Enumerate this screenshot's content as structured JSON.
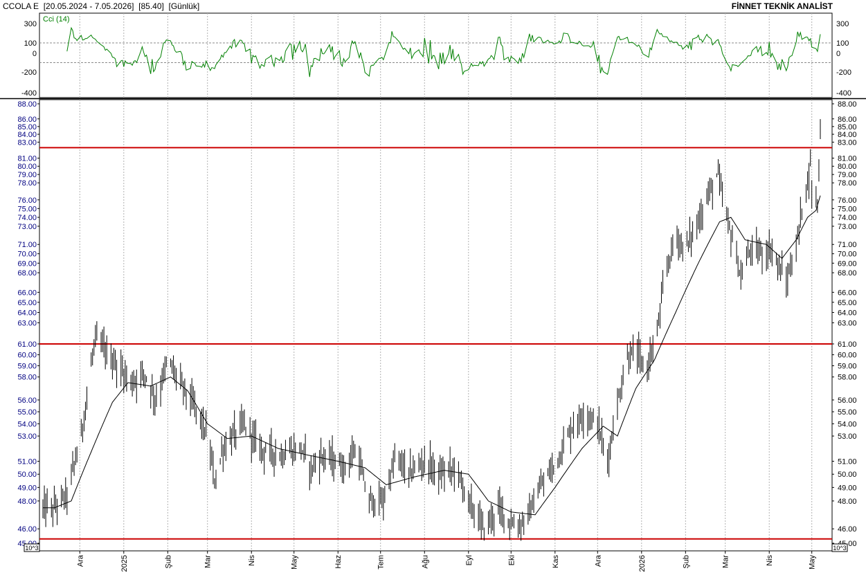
{
  "header": {
    "title": "CCOLA E  [20.05.2024 - 7.05.2026]  [85.40]  [Günlük]",
    "brand": "FİNNET TEKNİK ANALİST"
  },
  "chart_data": [
    {
      "type": "line",
      "title": "Cci (14)",
      "y_ticks": [
        -400,
        -200,
        0,
        100,
        300
      ],
      "y_range": [
        -430,
        330
      ],
      "reference_lines": [
        100,
        -100
      ],
      "grid": true,
      "color": "#008000"
    },
    {
      "type": "ohlc",
      "y_scale": "log",
      "y_range": [
        45,
        88.5
      ],
      "y_ticks": [
        "45.00",
        "46.00",
        "48.00",
        "49.00",
        "50.00",
        "51.00",
        "53.00",
        "54.00",
        "55.00",
        "56.00",
        "58.00",
        "59.00",
        "60.00",
        "61.00",
        "63.00",
        "64.00",
        "65.00",
        "66.00",
        "68.00",
        "69.00",
        "70.00",
        "71.00",
        "73.00",
        "74.00",
        "75.00",
        "76.00",
        "78.00",
        "79.00",
        "80.00",
        "81.00",
        "83.00",
        "84.00",
        "85.00",
        "86.00",
        "88.00"
      ],
      "scale_note": "10^3",
      "x_ticks": [
        "Ara",
        "2025",
        "Şub",
        "Mar",
        "Nis",
        "May",
        "Haz",
        "Tem",
        "Ağu",
        "Eyl",
        "Eki",
        "Kas",
        "Ara",
        "2026",
        "Şub",
        "Mar",
        "Nis",
        "May"
      ],
      "horizontal_lines": [
        82.3,
        61.0,
        45.3
      ],
      "horizontal_line_color": "#cc0000",
      "price_anchors": [
        [
          "Nov 13 2024",
          47.5
        ],
        [
          "Nov 22 2024",
          48.5
        ],
        [
          "Dec 2 2024",
          53
        ],
        [
          "Dec 12 2024",
          61.5
        ],
        [
          "Dec 24 2024",
          59.5
        ],
        [
          "Jan 7 2025",
          57.5
        ],
        [
          "Jan 15 2025",
          58.5
        ],
        [
          "Jan 24 2025",
          56
        ],
        [
          "Feb 1 2025",
          59.5
        ],
        [
          "Feb 10 2025",
          57.5
        ],
        [
          "Feb 22 2025",
          55
        ],
        [
          "Mar 1 2025",
          53
        ],
        [
          "Mar 6 2025",
          49.5
        ],
        [
          "Mar 12 2025",
          52
        ],
        [
          "Mar 26 2025",
          54
        ],
        [
          "Apr 8 2025",
          52
        ],
        [
          "Apr 22 2025",
          51.5
        ],
        [
          "May 6 2025",
          52
        ],
        [
          "May 13 2025",
          50.5
        ],
        [
          "May 22 2025",
          51.5
        ],
        [
          "Jun 5 2025",
          50.5
        ],
        [
          "Jun 14 2025",
          52
        ],
        [
          "Jun 22 2025",
          48
        ],
        [
          "Jul 3 2025",
          48
        ],
        [
          "Jul 12 2025",
          51.5
        ],
        [
          "Jul 20 2025",
          50
        ],
        [
          "Aug 1 2025",
          51
        ],
        [
          "Aug 12 2025",
          50
        ],
        [
          "Aug 23 2025",
          50.5
        ],
        [
          "Sep 1 2025",
          48
        ],
        [
          "Sep 12 2025",
          46
        ],
        [
          "Sep 22 2025",
          47.5
        ],
        [
          "Oct 5 2025",
          46
        ],
        [
          "Oct 13 2025",
          47
        ],
        [
          "Oct 22 2025",
          49
        ],
        [
          "Nov 2 2025",
          51
        ],
        [
          "Nov 12 2025",
          53.5
        ],
        [
          "Nov 22 2025",
          55
        ],
        [
          "Dec 1 2025",
          54
        ],
        [
          "Dec 8 2025",
          51
        ],
        [
          "Dec 14 2025",
          55
        ],
        [
          "Dec 22 2025",
          59.8
        ],
        [
          "Dec 28 2025",
          60.2
        ],
        [
          "Jan 4 2026",
          58.5
        ],
        [
          "Jan 12 2026",
          62
        ],
        [
          "Jan 18 2026",
          68
        ],
        [
          "Jan 25 2026",
          72
        ],
        [
          "Feb 1 2026",
          70.5
        ],
        [
          "Feb 10 2026",
          73.5
        ],
        [
          "Feb 18 2026",
          77
        ],
        [
          "Feb 24 2026",
          79
        ],
        [
          "Mar 1 2026",
          74.5
        ],
        [
          "Mar 7 2026",
          71
        ],
        [
          "Mar 12 2026",
          67.5
        ],
        [
          "Mar 19 2026",
          70.5
        ],
        [
          "Mar 27 2026",
          70
        ],
        [
          "Apr 3 2026",
          70.5
        ],
        [
          "Apr 8 2026",
          68.5
        ],
        [
          "Apr 13 2026",
          67
        ],
        [
          "Apr 20 2026",
          70.5
        ],
        [
          "Apr 25 2026",
          76
        ],
        [
          "Apr 30 2026",
          80
        ],
        [
          "May 2 2026",
          75
        ],
        [
          "May 5 2026",
          76
        ],
        [
          "May 6 2026",
          80
        ],
        [
          "May 7 2026",
          85.4
        ]
      ],
      "moving_average_anchors": [
        [
          "Nov 13 2024",
          47.5
        ],
        [
          "Nov 25 2024",
          48
        ],
        [
          "Dec 10 2024",
          52
        ],
        [
          "Dec 24 2024",
          55.8
        ],
        [
          "Jan 4 2025",
          57.5
        ],
        [
          "Jan 20 2025",
          57.2
        ],
        [
          "Feb 3 2025",
          58
        ],
        [
          "Feb 15 2025",
          56.8
        ],
        [
          "Mar 1 2025",
          54
        ],
        [
          "Mar 15 2025",
          52.8
        ],
        [
          "Apr 1 2025",
          53
        ],
        [
          "Apr 20 2025",
          52
        ],
        [
          "May 10 2025",
          51.5
        ],
        [
          "Jun 1 2025",
          51
        ],
        [
          "Jun 20 2025",
          50.5
        ],
        [
          "Jul 5 2025",
          49.2
        ],
        [
          "Jul 25 2025",
          49.8
        ],
        [
          "Aug 15 2025",
          50.3
        ],
        [
          "Sep 1 2025",
          50
        ],
        [
          "Sep 15 2025",
          48
        ],
        [
          "Oct 1 2025",
          47.2
        ],
        [
          "Oct 18 2025",
          47
        ],
        [
          "Nov 1 2025",
          49
        ],
        [
          "Nov 20 2025",
          52
        ],
        [
          "Dec 5 2025",
          53.8
        ],
        [
          "Dec 15 2025",
          53
        ],
        [
          "Dec 28 2025",
          57
        ],
        [
          "Jan 10 2026",
          59.5
        ],
        [
          "Jan 25 2026",
          64
        ],
        [
          "Feb 10 2026",
          69
        ],
        [
          "Feb 25 2026",
          73.5
        ],
        [
          "Mar 5 2026",
          74
        ],
        [
          "Mar 15 2026",
          71.5
        ],
        [
          "Mar 30 2026",
          71
        ],
        [
          "Apr 10 2026",
          69.5
        ],
        [
          "Apr 20 2026",
          71.5
        ],
        [
          "Apr 28 2026",
          74
        ],
        [
          "May 4 2026",
          74.8
        ],
        [
          "May 7 2026",
          76.5
        ]
      ]
    }
  ]
}
